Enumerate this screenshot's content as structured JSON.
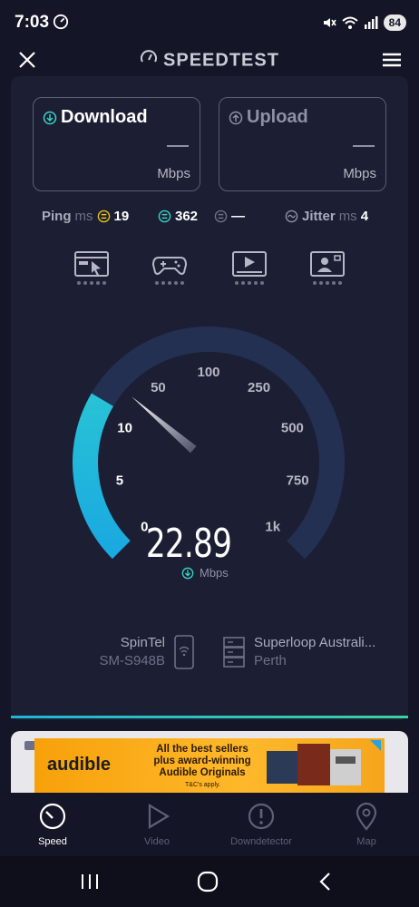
{
  "status_bar": {
    "time": "7:03",
    "battery": "84"
  },
  "app": {
    "title": "SPEEDTEST"
  },
  "results": {
    "download": {
      "label": "Download",
      "value": "—",
      "unit": "Mbps"
    },
    "upload": {
      "label": "Upload",
      "value": "—",
      "unit": "Mbps"
    }
  },
  "metrics": {
    "ping_label": "Ping",
    "ping_unit": "ms",
    "ping_idle": "19",
    "ping_download": "362",
    "ping_upload": "—",
    "jitter_label": "Jitter",
    "jitter_unit": "ms",
    "jitter_value": "4"
  },
  "gauge": {
    "labels": [
      "0",
      "5",
      "10",
      "50",
      "100",
      "250",
      "500",
      "750",
      "1k"
    ],
    "current_value": "22.89",
    "unit": "Mbps",
    "progress_fraction": 0.28
  },
  "connection": {
    "isp": "SpinTel",
    "device": "SM-S948B",
    "server": "Superloop Australi...",
    "server_location": "Perth"
  },
  "ad": {
    "logo_text": "audible",
    "headline": "All the best sellers plus award-winning Audible Originals",
    "tc": "T&C's apply."
  },
  "nav": {
    "items": [
      {
        "label": "Speed",
        "icon": "speedometer-icon"
      },
      {
        "label": "Video",
        "icon": "play-icon"
      },
      {
        "label": "Downdetector",
        "icon": "alert-icon"
      },
      {
        "label": "Map",
        "icon": "map-pin-icon"
      }
    ]
  },
  "colors": {
    "accent": "#1fb6d8",
    "background": "#141526",
    "panel": "#1c1f33"
  }
}
